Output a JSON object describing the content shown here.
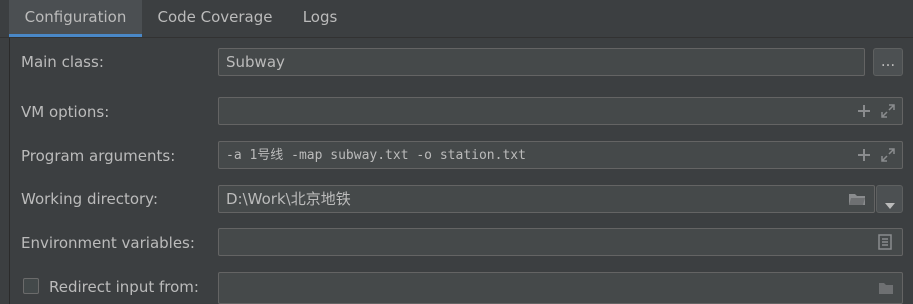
{
  "tabs": [
    {
      "label": "Configuration",
      "active": true
    },
    {
      "label": "Code Coverage",
      "active": false
    },
    {
      "label": "Logs",
      "active": false
    }
  ],
  "form": {
    "main_class": {
      "label": "Main class:",
      "value": "Subway",
      "browse_label": "..."
    },
    "vm_options": {
      "label": "VM options:",
      "value": ""
    },
    "program_arguments": {
      "label": "Program arguments:",
      "value": "-a 1号线 -map subway.txt -o station.txt"
    },
    "working_directory": {
      "label": "Working directory:",
      "value": "D:\\Work\\北京地铁"
    },
    "environment_variables": {
      "label": "Environment variables:",
      "value": ""
    },
    "redirect_input": {
      "label": "Redirect input from:",
      "checked": false,
      "value": ""
    }
  },
  "icons": {
    "expand": "plus-icon",
    "fullscreen": "expand-icon",
    "folder": "folder-icon",
    "dropdown": "chevron-down-icon",
    "document": "document-icon"
  },
  "colors": {
    "background": "#3c3f41",
    "field_bg": "#45494a",
    "field_border": "#646464",
    "text": "#bbbbbb",
    "accent": "#4a88c7"
  }
}
